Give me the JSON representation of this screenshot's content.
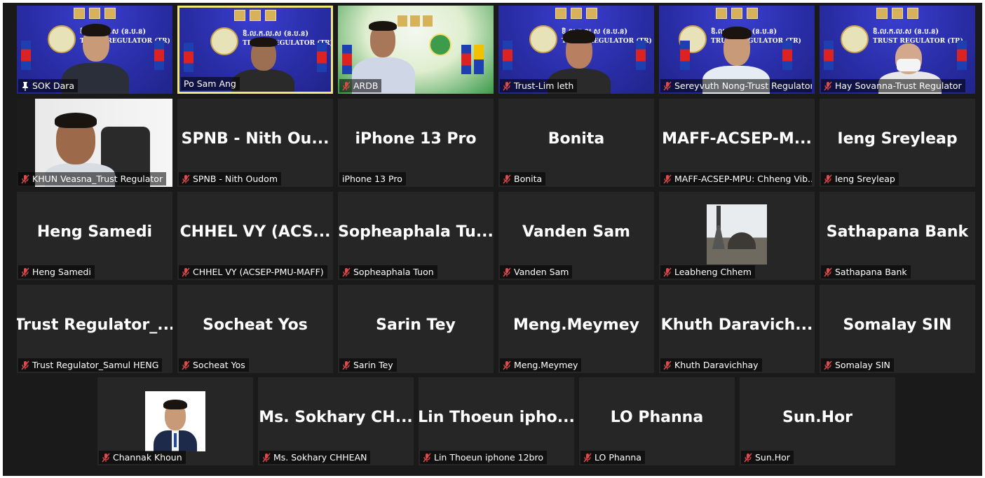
{
  "participants": [
    {
      "tile_text": "",
      "label": "SOK Dara",
      "icon": "pin-icon",
      "video": true
    },
    {
      "tile_text": "",
      "label": "Po Sam Ang",
      "icon": "none",
      "video": true,
      "active": true
    },
    {
      "tile_text": "",
      "label": "ARDB",
      "icon": "mic-muted-icon",
      "video": true
    },
    {
      "tile_text": "",
      "label": "Trust-Lim leth",
      "icon": "mic-muted-icon",
      "video": true
    },
    {
      "tile_text": "",
      "label": "Sereyvuth Nong-Trust Regulator",
      "icon": "mic-muted-icon",
      "video": true
    },
    {
      "tile_text": "",
      "label": "Hay Sovanna-Trust Regulator",
      "icon": "mic-muted-icon",
      "video": true
    },
    {
      "tile_text": "",
      "label": "KHUN Veasna_Trust Regulator",
      "icon": "mic-muted-icon",
      "video": true
    },
    {
      "tile_text": "SPNB - Nith Ou...",
      "label": "SPNB - Nith Oudom",
      "icon": "mic-muted-icon"
    },
    {
      "tile_text": "iPhone 13 Pro",
      "label": "iPhone 13 Pro",
      "icon": "none"
    },
    {
      "tile_text": "Bonita",
      "label": "Bonita",
      "icon": "mic-muted-icon"
    },
    {
      "tile_text": "MAFF-ACSEP-M...",
      "label": "MAFF-ACSEP-MPU: Chheng Vib...",
      "icon": "mic-muted-icon"
    },
    {
      "tile_text": "Ieng Sreyleap",
      "label": "Ieng Sreyleap",
      "icon": "mic-muted-icon"
    },
    {
      "tile_text": "Heng Samedi",
      "label": "Heng Samedi",
      "icon": "mic-muted-icon"
    },
    {
      "tile_text": "CHHEL VY (ACS...",
      "label": "CHHEL VY (ACSEP-PMU-MAFF)",
      "icon": "mic-muted-icon"
    },
    {
      "tile_text": "Sopheaphala Tu...",
      "label": "Sopheaphala Tuon",
      "icon": "mic-muted-icon"
    },
    {
      "tile_text": "Vanden Sam",
      "label": "Vanden Sam",
      "icon": "mic-muted-icon"
    },
    {
      "tile_text": "",
      "label": "Leabheng Chhem",
      "icon": "mic-muted-icon",
      "avatar": "tower"
    },
    {
      "tile_text": "Sathapana Bank",
      "label": "Sathapana Bank",
      "icon": "mic-muted-icon"
    },
    {
      "tile_text": "Trust  Regulator_...",
      "label": "Trust Regulator_Samul HENG",
      "icon": "mic-muted-icon"
    },
    {
      "tile_text": "Socheat Yos",
      "label": "Socheat Yos",
      "icon": "mic-muted-icon"
    },
    {
      "tile_text": "Sarin Tey",
      "label": "Sarin Tey",
      "icon": "mic-muted-icon"
    },
    {
      "tile_text": "Meng.Meymey",
      "label": "Meng.Meymey",
      "icon": "mic-muted-icon"
    },
    {
      "tile_text": "Khuth  Daravich...",
      "label": "Khuth Daravichhay",
      "icon": "mic-muted-icon"
    },
    {
      "tile_text": "Somalay SIN",
      "label": "Somalay SIN",
      "icon": "mic-muted-icon"
    },
    {
      "tile_text": "",
      "label": "Channak Khoun",
      "icon": "mic-muted-icon",
      "avatar": "portrait"
    },
    {
      "tile_text": "Ms. Sokhary CH...",
      "label": "Ms. Sokhary CHHEAN",
      "icon": "mic-muted-icon"
    },
    {
      "tile_text": "Lin Thoeun  ipho...",
      "label": "Lin Thoeun iphone 12bro",
      "icon": "mic-muted-icon"
    },
    {
      "tile_text": "LO Phanna",
      "label": "LO Phanna",
      "icon": "mic-muted-icon"
    },
    {
      "tile_text": "Sun.Hor",
      "label": "Sun.Hor",
      "icon": "mic-muted-icon"
    }
  ],
  "backdrop": {
    "trust_regulator_line1": "ឱ.ល.ក.ល.ស (ន.ប.ន)",
    "trust_regulator_line2": "TRUST REGULATOR (TR)"
  },
  "colors": {
    "stage_bg": "#1a1a1a",
    "tile_bg": "#262626",
    "active_border": "#f2e87a",
    "muted_icon": "#e04a4a"
  }
}
